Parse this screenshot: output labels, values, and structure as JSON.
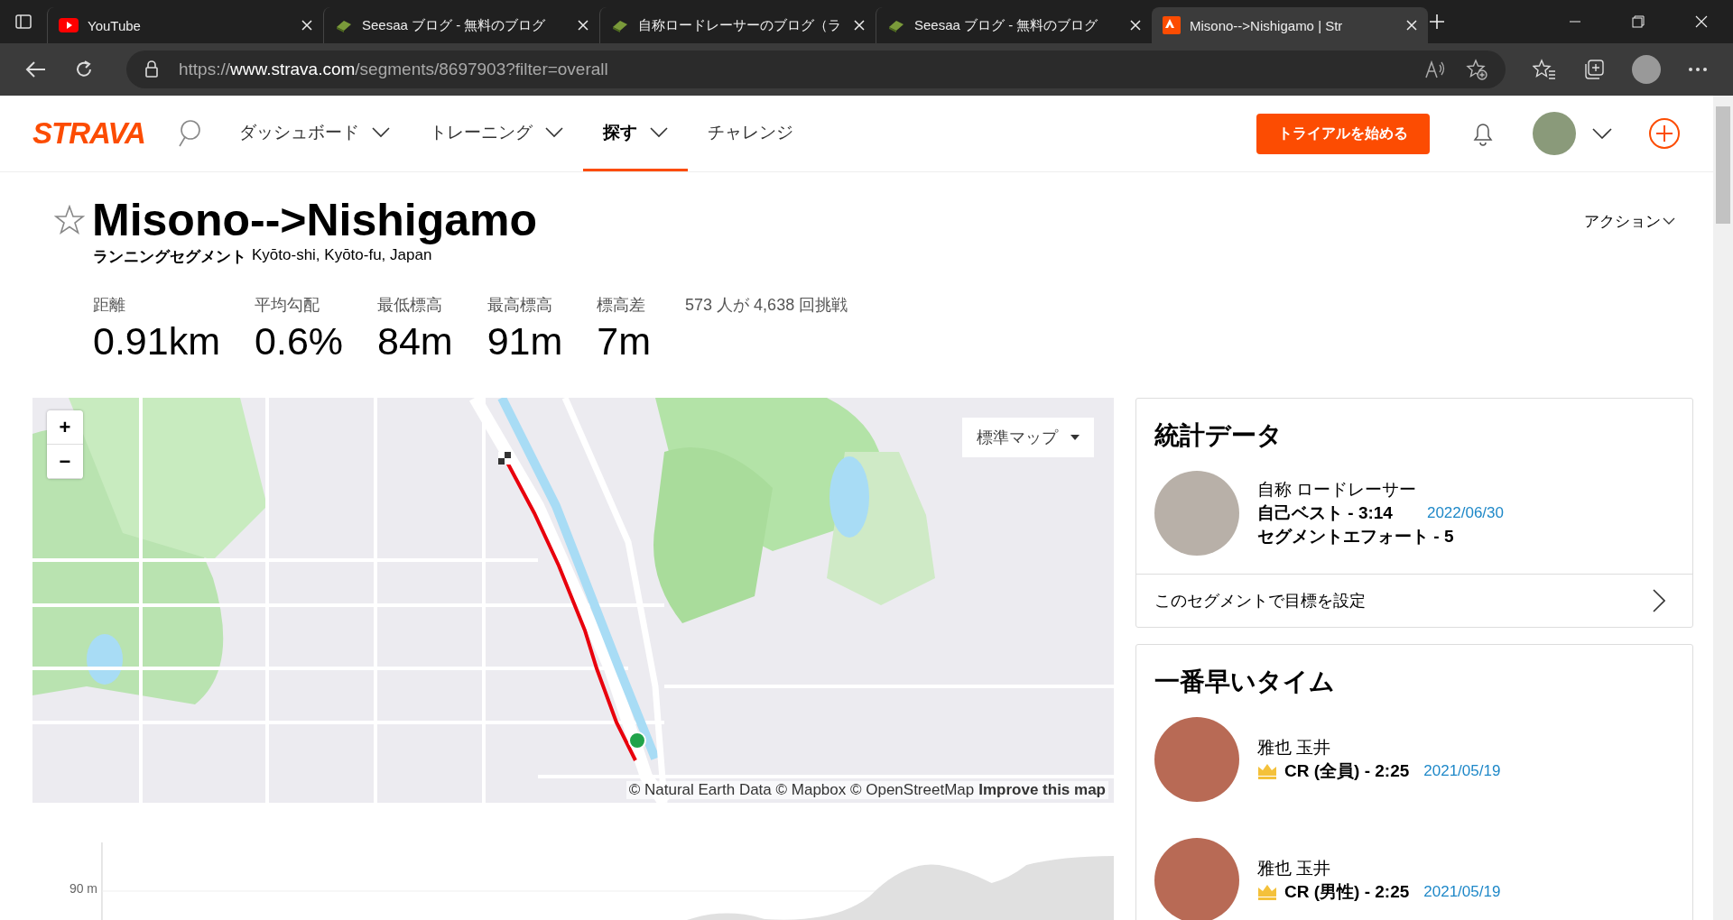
{
  "browser": {
    "tabs": [
      {
        "title": "YouTube",
        "kind": "video",
        "selected": false
      },
      {
        "title": "Seesaa ブログ - 無料のブログ",
        "kind": "blog",
        "selected": false
      },
      {
        "title": "自称ロードレーサーのブログ（ラ",
        "kind": "blog",
        "selected": false
      },
      {
        "title": "Seesaa ブログ - 無料のブログ",
        "kind": "blog",
        "selected": false
      },
      {
        "title": "Misono-->Nishigamo | Str",
        "kind": "segment",
        "selected": true
      }
    ],
    "url": "https://**www.strava.com**/segments/8697903?filter=overall"
  },
  "nav": {
    "logo": "STRAVA",
    "items": [
      {
        "label": "ダッシュボード",
        "dropdown": true,
        "selected": false
      },
      {
        "label": "トレーニング",
        "dropdown": true,
        "selected": false
      },
      {
        "label": "探す",
        "dropdown": true,
        "selected": true
      },
      {
        "label": "チャレンジ",
        "dropdown": false,
        "selected": false
      }
    ],
    "trial_button": "トライアルを始める"
  },
  "segment": {
    "starred": false,
    "title": "Misono-->Nishigamo",
    "type": "ランニングセグメント",
    "location": "Kyōto-shi, Kyōto-fu, Japan",
    "actions": "アクション",
    "stats": [
      {
        "label": "距離",
        "value": "0.91km"
      },
      {
        "label": "平均勾配",
        "value": "0.6%"
      },
      {
        "label": "最低標高",
        "value": "84m"
      },
      {
        "label": "最高標高",
        "value": "91m"
      },
      {
        "label": "標高差",
        "value": "7m"
      }
    ],
    "attempts": "573 人が 4,638 回挑戦"
  },
  "map": {
    "zoom_in": "+",
    "zoom_out": "−",
    "style_button": "標準マップ",
    "attribution": "© Natural Earth Data © Mapbox © OpenStreetMap",
    "improve_link": "Improve this map"
  },
  "stats_card": {
    "title": "統計データ",
    "athlete": "自称 ロードレーサー",
    "personal_best": "自己ベスト - 3:14",
    "date": "2022/06/30",
    "efforts": "セグメントエフォート - 5",
    "goal_link": "このセグメントで目標を設定"
  },
  "leaderboard": {
    "title": "一番早いタイム",
    "entries": [
      {
        "name": "雅也 玉井",
        "record": "CR (全員) - 2:25",
        "date": "2021/05/19"
      },
      {
        "name": "雅也 玉井",
        "record": "CR (男性) - 2:25",
        "date": "2021/05/19"
      }
    ]
  },
  "elevation": {
    "tick": "90 m"
  }
}
